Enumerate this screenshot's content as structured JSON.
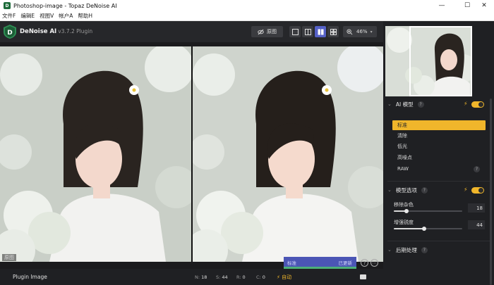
{
  "window": {
    "title": "Photoshop-image - Topaz DeNoise AI",
    "minimize": "—",
    "maximize": "☐",
    "close": "✕"
  },
  "menu": {
    "items": [
      "文件F",
      "编辑E",
      "视图V",
      "帐户A",
      "帮助H"
    ]
  },
  "toolbar": {
    "brand": "DeNoise AI",
    "version": "v3.7.2 Plugin",
    "original_label": "原图",
    "zoom": "46%",
    "view_active": "split-side-by-side"
  },
  "preview": {
    "original_label": "原图",
    "compare_left": "标准",
    "compare_right": "已更新"
  },
  "status": {
    "plugin_label": "Plugin Image",
    "n_label": "N:",
    "n_value": "18",
    "s_label": "S:",
    "s_value": "44",
    "r_label": "R:",
    "r_value": "0",
    "c_label": "C:",
    "c_value": "0",
    "auto_label": "自动"
  },
  "panel": {
    "ai_model": {
      "title": "AI 模型",
      "help": "?",
      "options": [
        "标准",
        "清除",
        "低光",
        "高噪点",
        "RAW"
      ],
      "selected": "标准"
    },
    "model_options": {
      "title": "模型选项",
      "help": "?",
      "remove_noise_label": "移除杂色",
      "remove_noise_value": "18",
      "enhance_sharpness_label": "增强锐度",
      "enhance_sharpness_value": "44"
    },
    "post_processing": {
      "title": "后期处理",
      "help": "?"
    }
  },
  "colors": {
    "accent": "#f0b62b",
    "compare_bar": "#4b55b5",
    "active_view": "#5561c7"
  }
}
